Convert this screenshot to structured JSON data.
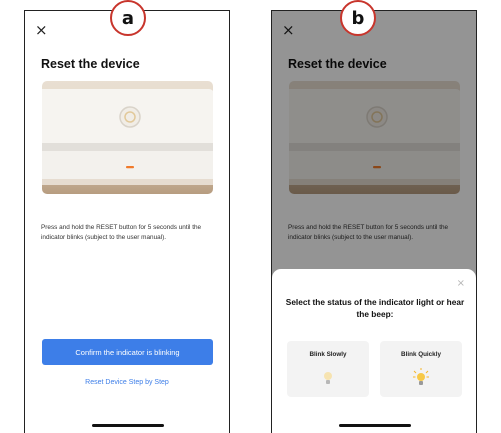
{
  "badges": {
    "a": "a",
    "b": "b"
  },
  "screen": {
    "close_icon": "×",
    "title": "Reset the device",
    "image_alt": "white device with orange indicator light",
    "description": "Press and hold the RESET button for 5 seconds until the indicator blinks (subject to the user manual).",
    "confirm_button": "Confirm the indicator is blinking",
    "step_link": "Reset Device Step by Step"
  },
  "sheet": {
    "close_icon": "×",
    "title": "Select the status of the indicator light or hear the beep:",
    "options": [
      {
        "label": "Blink Slowly",
        "icon": "bulb-dim-icon"
      },
      {
        "label": "Blink Quickly",
        "icon": "bulb-lit-icon"
      }
    ]
  },
  "colors": {
    "accent": "#3d7ee8",
    "badge_ring": "#c8352c",
    "indicator": "#f07a2a"
  }
}
